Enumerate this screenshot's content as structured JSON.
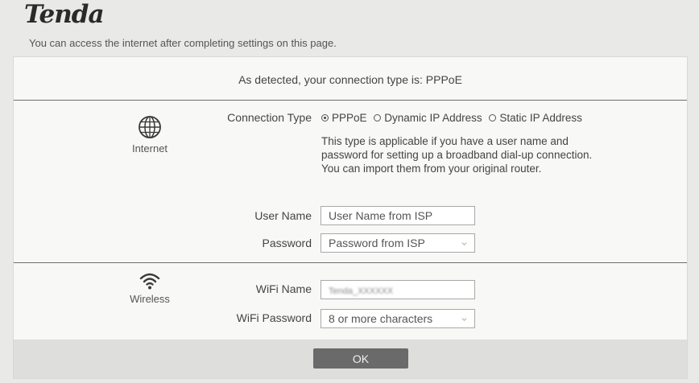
{
  "header": {
    "logo_text": "Tenda",
    "subtitle": "You can access the internet after completing settings on this page."
  },
  "detected": {
    "text": "As detected, your connection type is: PPPoE"
  },
  "internet": {
    "section_label": "Internet",
    "icon": "globe-icon",
    "connection_type_label": "Connection Type",
    "options": [
      {
        "label": "PPPoE",
        "checked": true
      },
      {
        "label": "Dynamic IP Address",
        "checked": false
      },
      {
        "label": "Static IP Address",
        "checked": false
      }
    ],
    "description": "This type is applicable if you have a user name and password for setting up a broadband dial-up connection. You can import them from your original router.",
    "username_label": "User Name",
    "username_placeholder": "User Name from ISP",
    "password_label": "Password",
    "password_placeholder": "Password from ISP"
  },
  "wireless": {
    "section_label": "Wireless",
    "icon": "wifi-icon",
    "wifi_name_label": "WiFi Name",
    "wifi_name_value": "Tenda_XXXXXX",
    "wifi_password_label": "WiFi Password",
    "wifi_password_placeholder": "8 or more characters"
  },
  "footer": {
    "ok_label": "OK"
  }
}
